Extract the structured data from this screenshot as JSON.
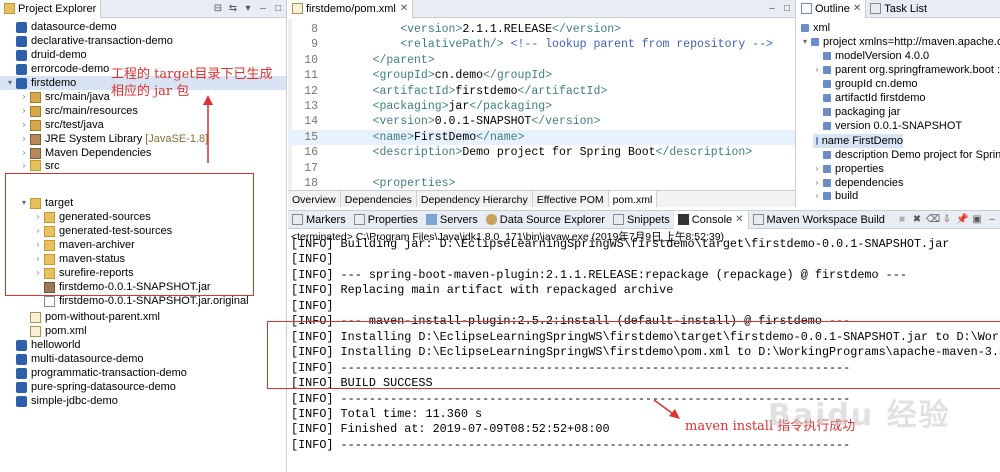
{
  "project_explorer": {
    "title": "Project Explorer",
    "items": [
      {
        "label": "datasource-demo",
        "extra": ""
      },
      {
        "label": "declarative-transaction-demo",
        "extra": ""
      },
      {
        "label": "druid-demo",
        "extra": ""
      },
      {
        "label": "errorcode-demo",
        "extra": ""
      },
      {
        "label": "firstdemo",
        "extra": ""
      },
      {
        "label": "src/main/java",
        "extra": ""
      },
      {
        "label": "src/main/resources",
        "extra": ""
      },
      {
        "label": "src/test/java",
        "extra": ""
      },
      {
        "label": "JRE System Library",
        "extra": "[JavaSE-1.8]"
      },
      {
        "label": "Maven Dependencies",
        "extra": ""
      },
      {
        "label": "src",
        "extra": ""
      },
      {
        "label": "target",
        "extra": ""
      },
      {
        "label": "generated-sources",
        "extra": ""
      },
      {
        "label": "generated-test-sources",
        "extra": ""
      },
      {
        "label": "maven-archiver",
        "extra": ""
      },
      {
        "label": "maven-status",
        "extra": ""
      },
      {
        "label": "surefire-reports",
        "extra": ""
      },
      {
        "label": "firstdemo-0.0.1-SNAPSHOT.jar",
        "extra": ""
      },
      {
        "label": "firstdemo-0.0.1-SNAPSHOT.jar.original",
        "extra": ""
      },
      {
        "label": "pom-without-parent.xml",
        "extra": ""
      },
      {
        "label": "pom.xml",
        "extra": ""
      },
      {
        "label": "helloworld",
        "extra": ""
      },
      {
        "label": "multi-datasource-demo",
        "extra": ""
      },
      {
        "label": "programmatic-transaction-demo",
        "extra": ""
      },
      {
        "label": "pure-spring-datasource-demo",
        "extra": ""
      },
      {
        "label": "simple-jdbc-demo",
        "extra": ""
      }
    ]
  },
  "editor": {
    "tab_title": "firstdemo/pom.xml",
    "lines": [
      {
        "num": "8",
        "text": "        <version>2.1.1.RELEASE</version>"
      },
      {
        "num": "9",
        "text": "        <relativePath/> <!-- lookup parent from repository -->"
      },
      {
        "num": "10",
        "text": "    </parent>"
      },
      {
        "num": "11",
        "text": "    <groupId>cn.demo</groupId>"
      },
      {
        "num": "12",
        "text": "    <artifactId>firstdemo</artifactId>"
      },
      {
        "num": "13",
        "text": "    <packaging>jar</packaging>"
      },
      {
        "num": "14",
        "text": "    <version>0.0.1-SNAPSHOT</version>"
      },
      {
        "num": "15",
        "text": "    <name>FirstDemo</name>"
      },
      {
        "num": "16",
        "text": "    <description>Demo project for Spring Boot</description>"
      },
      {
        "num": "17",
        "text": ""
      },
      {
        "num": "18",
        "text": "    <properties>"
      }
    ],
    "bottom_tabs": [
      "Overview",
      "Dependencies",
      "Dependency Hierarchy",
      "Effective POM",
      "pom.xml"
    ]
  },
  "outline": {
    "tabs": [
      "Outline",
      "Task List"
    ],
    "items": [
      "xml",
      "project xmlns=http://maven.apache.or",
      "modelVersion  4.0.0",
      "parent  org.springframework.boot :",
      "groupId  cn.demo",
      "artifactId  firstdemo",
      "packaging  jar",
      "version  0.0.1-SNAPSHOT",
      "name  FirstDemo",
      "description  Demo project for Sprin",
      "properties",
      "dependencies",
      "build"
    ]
  },
  "console": {
    "tabs": [
      "Markers",
      "Properties",
      "Servers",
      "Data Source Explorer",
      "Snippets",
      "Console",
      "Maven Workspace Build"
    ],
    "terminated": "<terminated> C:\\Program Files\\Java\\jdk1.8.0_171\\bin\\javaw.exe (2019年7月9日 上午8:52:39)",
    "lines": [
      "[INFO] Building jar: D:\\EclipseLearningSpringWS\\firstdemo\\target\\firstdemo-0.0.1-SNAPSHOT.jar",
      "[INFO]",
      "[INFO] --- spring-boot-maven-plugin:2.1.1.RELEASE:repackage (repackage) @ firstdemo ---",
      "[INFO] Replacing main artifact with repackaged archive",
      "[INFO]",
      "[INFO] --- maven-install-plugin:2.5.2:install (default-install) @ firstdemo ---",
      "[INFO] Installing D:\\EclipseLearningSpringWS\\firstdemo\\target\\firstdemo-0.0.1-SNAPSHOT.jar to D:\\Workin",
      "[INFO] Installing D:\\EclipseLearningSpringWS\\firstdemo\\pom.xml to D:\\WorkingPrograms\\apache-maven-3.5.4",
      "[INFO] ------------------------------------------------------------------------",
      "[INFO] BUILD SUCCESS",
      "[INFO] ------------------------------------------------------------------------",
      "[INFO] Total time: 11.360 s",
      "[INFO] Finished at: 2019-07-09T08:52:52+08:00",
      "[INFO] ------------------------------------------------------------------------"
    ]
  },
  "annotations": {
    "explorer_note_line1": "工程的  target目录下已生成",
    "explorer_note_line2": "相应的  jar  包",
    "console_note": "maven install 指令执行成功",
    "watermark": "Baidu 经验",
    "color": "#e03030"
  }
}
